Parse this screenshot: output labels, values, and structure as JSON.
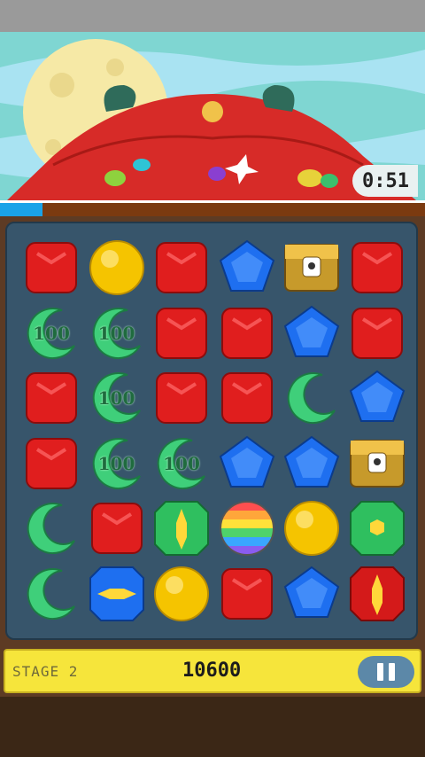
{
  "game": {
    "timer": "0:51",
    "progress_fraction": 0.1,
    "stage_label": "STAGE 2",
    "score": "10600"
  },
  "board": {
    "rows": [
      [
        "red",
        "yellow",
        "red",
        "blue",
        "chest",
        "red"
      ],
      [
        "green-100",
        "green-100",
        "red",
        "red",
        "blue",
        "red"
      ],
      [
        "red",
        "green-100",
        "red",
        "red",
        "green",
        "blue"
      ],
      [
        "red",
        "green-100",
        "green-100",
        "blue",
        "blue",
        "chest"
      ],
      [
        "green",
        "red",
        "green-vstripe",
        "rainbow",
        "yellow",
        "green-hex"
      ],
      [
        "green",
        "blue-hstripe",
        "yellow",
        "red",
        "blue",
        "red-vstripe"
      ]
    ],
    "bonus_label": "100"
  },
  "colors": {
    "red": "#e01e1e",
    "yellow": "#f5c400",
    "blue": "#1e6ff0",
    "green": "#3fcf7a",
    "chest": "#c79a2b"
  }
}
